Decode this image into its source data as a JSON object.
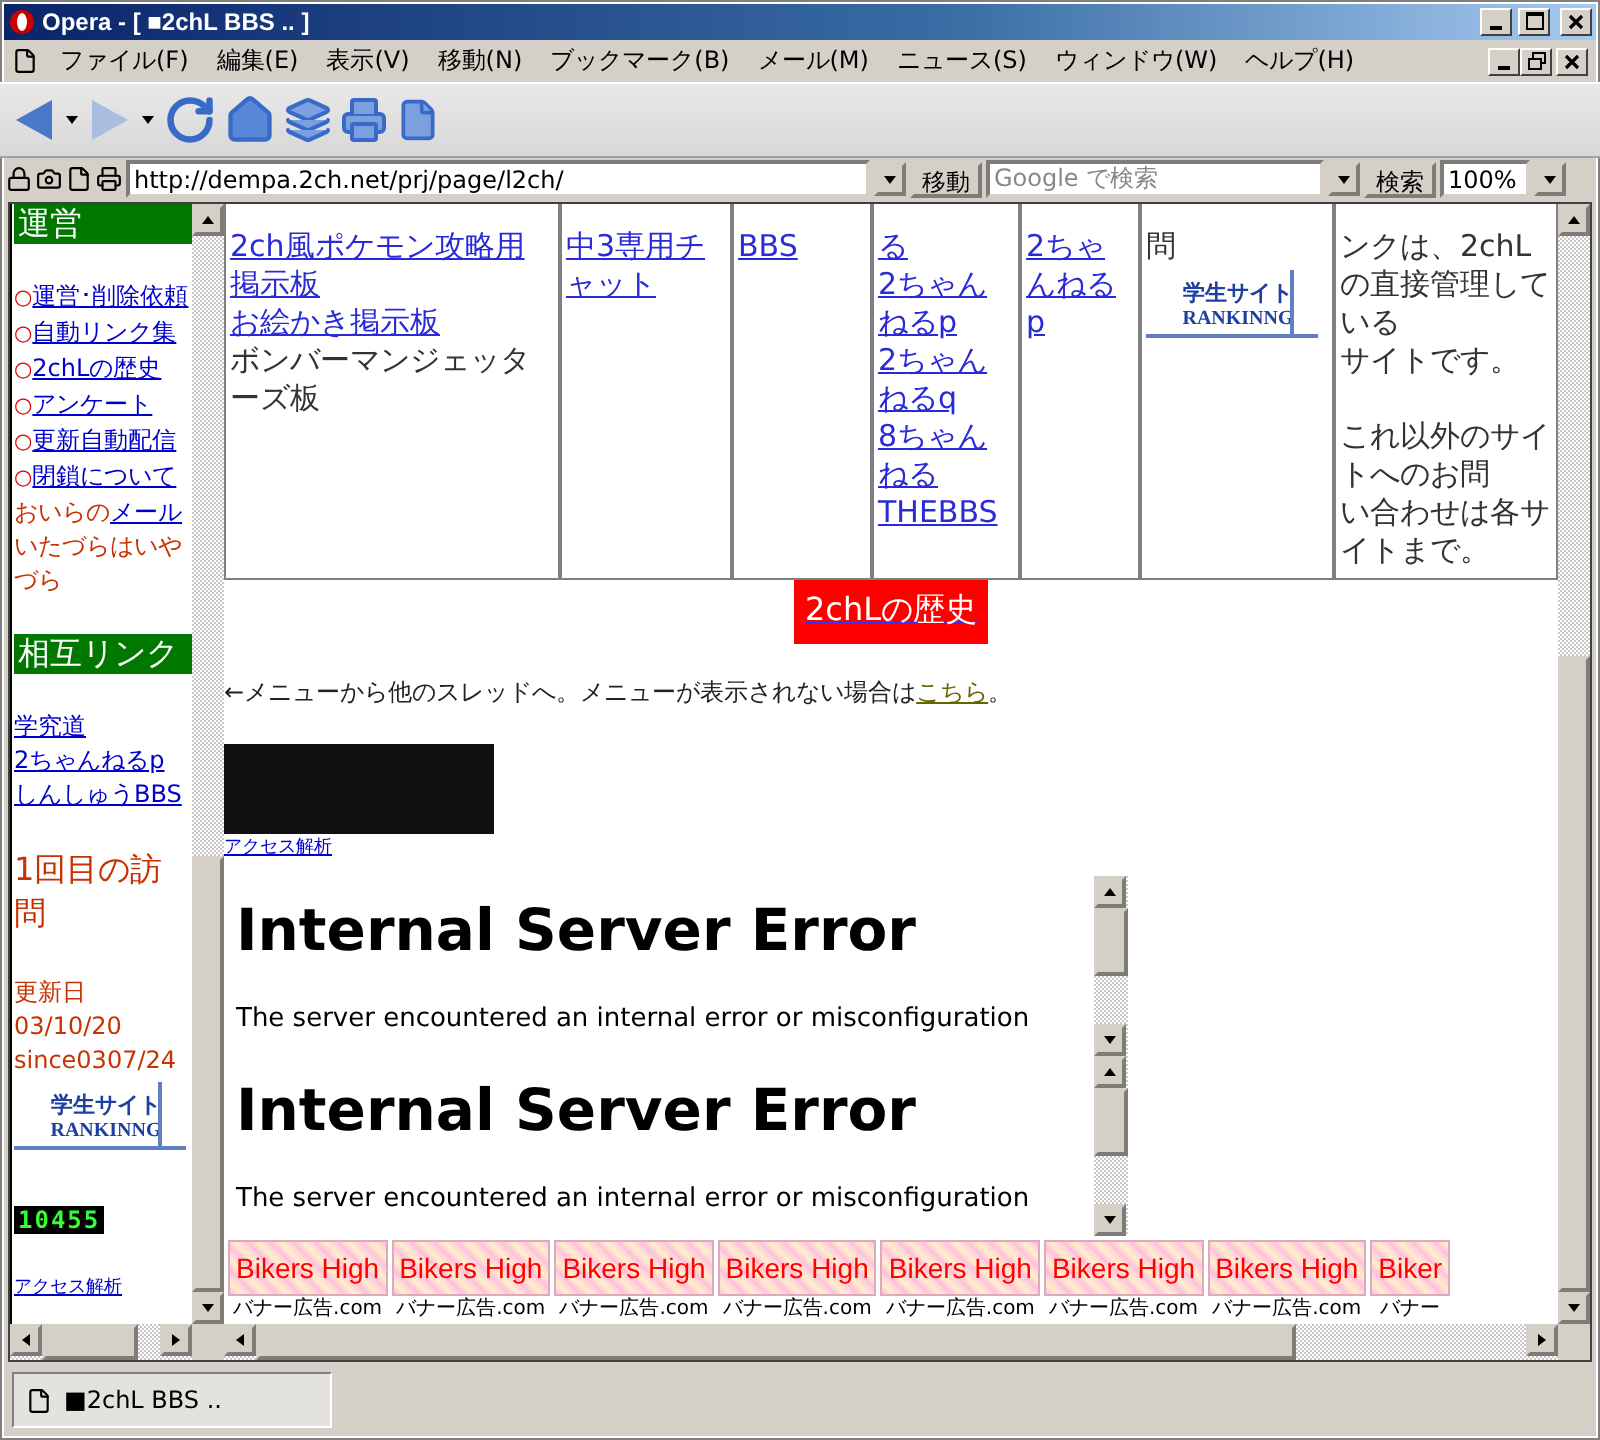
{
  "window": {
    "title": "Opera - [ ■2chL BBS .. ]"
  },
  "menu": [
    "ファイル(F)",
    "編集(E)",
    "表示(V)",
    "移動(N)",
    "ブックマーク(B)",
    "メール(M)",
    "ニュース(S)",
    "ウィンドウ(W)",
    "ヘルプ(H)"
  ],
  "address_bar": {
    "url": "http://dempa.2ch.net/prj/page/l2ch/",
    "go_button": "移動",
    "search_placeholder": "Google で検索",
    "search_button": "検索",
    "zoom": "100%"
  },
  "left_frame": [
    {
      "kind": "heading",
      "text": "運営"
    },
    {
      "kind": "bullet_link",
      "bullet": "○",
      "text": "運営･削除依頼"
    },
    {
      "kind": "bullet_link",
      "bullet": "○",
      "text": "自動リンク集"
    },
    {
      "kind": "bullet_link",
      "bullet": "○",
      "text": "2chLの歴史"
    },
    {
      "kind": "bullet_link",
      "bullet": "○",
      "text": "アンケート"
    },
    {
      "kind": "bullet_link",
      "bullet": "○",
      "text": "更新自動配信"
    },
    {
      "kind": "bullet_link",
      "bullet": "○",
      "text": "閉鎖について"
    },
    {
      "kind": "text_link",
      "before": "おいらの",
      "link": "メール"
    },
    {
      "kind": "note",
      "text": "いたづらはいやづら"
    },
    {
      "kind": "heading",
      "text": "相互リンク"
    },
    {
      "kind": "link",
      "text": "学究道"
    },
    {
      "kind": "link",
      "text": "2ちゃんねるp"
    },
    {
      "kind": "link",
      "text": "しんしゅうBBS"
    },
    {
      "kind": "visits",
      "text": "1回目の訪問"
    },
    {
      "kind": "note",
      "text": "更新日03/10/20"
    },
    {
      "kind": "note",
      "text": "since0307/24"
    },
    {
      "kind": "ranking",
      "line1": "学生サイト",
      "line2": "RANKINNG"
    },
    {
      "kind": "counter",
      "text": "10455"
    },
    {
      "kind": "small_link",
      "text": "アクセス解析"
    }
  ],
  "link_table": [
    {
      "items": [
        {
          "kind": "link",
          "text": "2ch風ポケモン攻略用掲示板"
        },
        {
          "kind": "link",
          "text": "お絵かき掲示板"
        },
        {
          "kind": "text",
          "text": "ボンバーマンジェッターズ板"
        }
      ]
    },
    {
      "items": [
        {
          "kind": "link",
          "text": "中3専用チャット"
        }
      ]
    },
    {
      "items": [
        {
          "kind": "link",
          "text": "BBS"
        }
      ]
    },
    {
      "items": [
        {
          "kind": "link",
          "text": "る"
        },
        {
          "kind": "link",
          "text": "2ちゃんねるp"
        },
        {
          "kind": "link",
          "text": "2ちゃんねるq"
        },
        {
          "kind": "link",
          "text": "8ちゃんねる"
        },
        {
          "kind": "link",
          "text": "THEBBS"
        }
      ]
    },
    {
      "items": [
        {
          "kind": "link",
          "text": "2ちゃんねるp"
        }
      ]
    },
    {
      "items": [
        {
          "kind": "text",
          "text": "問"
        },
        {
          "kind": "ranking",
          "line1": "学生サイト",
          "line2": "RANKINNG"
        }
      ]
    },
    {
      "items": [
        {
          "kind": "text",
          "text": "ンクは、2chLの直接管理している"
        },
        {
          "kind": "text",
          "text": "サイトです。"
        },
        {
          "kind": "break"
        },
        {
          "kind": "text",
          "text": "これ以外のサイトへのお問"
        },
        {
          "kind": "text",
          "text": "い合わせは各サイトまで。"
        }
      ]
    }
  ],
  "history_button": "2chLの歴史",
  "menu_hint": {
    "before": "←メニューから他のスレッドへ。メニューが表示されない場合は",
    "link": "こちら",
    "after": "。"
  },
  "access_link": "アクセス解析",
  "frames": [
    {
      "heading": "Internal Server Error",
      "text": "The server encountered an internal error or misconfiguration"
    },
    {
      "heading": "Internal Server Error",
      "text": "The server encountered an internal error or misconfiguration"
    }
  ],
  "banners": [
    {
      "title": "Bikers High",
      "caption": "バナー広告.com"
    },
    {
      "title": "Bikers High",
      "caption": "バナー広告.com"
    },
    {
      "title": "Bikers High",
      "caption": "バナー広告.com"
    },
    {
      "title": "Bikers High",
      "caption": "バナー広告.com"
    },
    {
      "title": "Bikers High",
      "caption": "バナー広告.com"
    },
    {
      "title": "Bikers High",
      "caption": "バナー広告.com"
    },
    {
      "title": "Bikers High",
      "caption": "バナー広告.com"
    },
    {
      "title": "Biker",
      "caption": "バナー"
    }
  ],
  "tabs": [
    {
      "label": "■2chL BBS ..",
      "selected": true
    }
  ]
}
